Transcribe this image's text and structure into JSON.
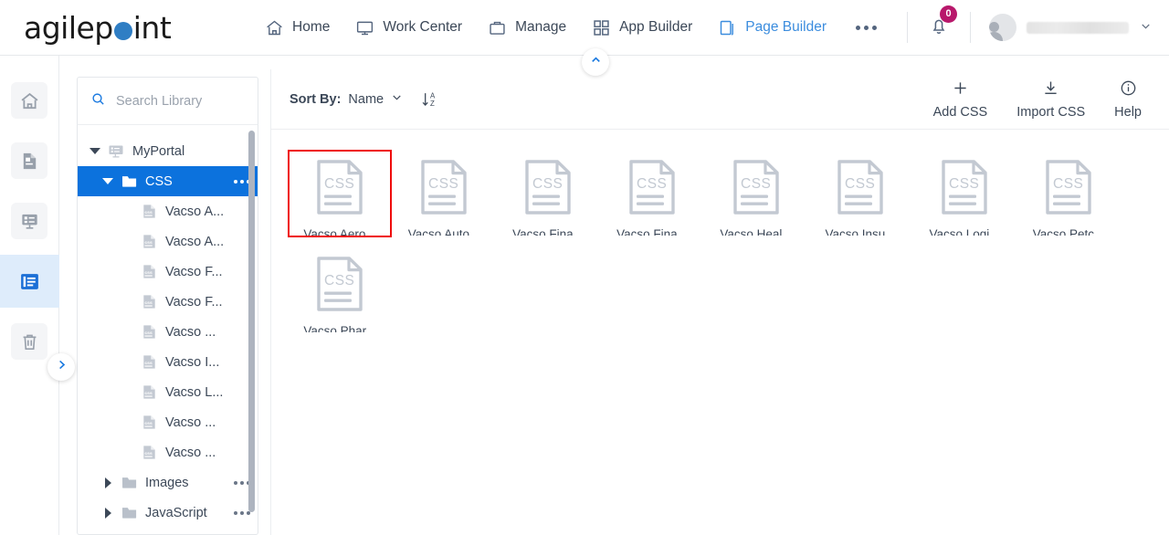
{
  "brand": {
    "name_part1": "agilep",
    "name_part2": "int",
    "dot_color": "#2f7ec4"
  },
  "header": {
    "nav": [
      {
        "label": "Home",
        "icon": "home-icon",
        "active": false
      },
      {
        "label": "Work Center",
        "icon": "monitor-icon",
        "active": false
      },
      {
        "label": "Manage",
        "icon": "briefcase-icon",
        "active": false
      },
      {
        "label": "App Builder",
        "icon": "grid-squares-icon",
        "active": false
      },
      {
        "label": "Page Builder",
        "icon": "pages-icon",
        "active": true
      }
    ],
    "more_label": "More",
    "notifications": {
      "count": "0",
      "badge_color": "#b8186b"
    },
    "user": {
      "name": "",
      "redacted": true
    }
  },
  "collapse_button": {
    "name": "collapse-header-button",
    "direction": "up"
  },
  "left_rail": {
    "items": [
      {
        "label": "Home",
        "icon": "home-icon",
        "active": false
      },
      {
        "label": "Pages",
        "icon": "page-icon",
        "active": false
      },
      {
        "label": "Forms",
        "icon": "form-icon",
        "active": false
      },
      {
        "label": "Library",
        "icon": "library-icon",
        "active": true
      },
      {
        "label": "Recycle Bin",
        "icon": "trash-icon",
        "active": false
      }
    ],
    "expand_label": "Expand"
  },
  "library": {
    "search": {
      "placeholder": "Search Library",
      "value": ""
    },
    "tree": [
      {
        "label": "MyPortal",
        "icon": "portal-icon",
        "depth": 0,
        "state": "expanded",
        "selected": false,
        "menu": false
      },
      {
        "label": "CSS",
        "icon": "folder-icon",
        "depth": 1,
        "state": "expanded",
        "selected": true,
        "menu": true
      },
      {
        "label": "Vacso A...",
        "icon": "css-file-icon",
        "depth": 2,
        "state": "leaf",
        "selected": false,
        "menu": false
      },
      {
        "label": "Vacso A...",
        "icon": "css-file-icon",
        "depth": 2,
        "state": "leaf",
        "selected": false,
        "menu": false
      },
      {
        "label": "Vacso F...",
        "icon": "css-file-icon",
        "depth": 2,
        "state": "leaf",
        "selected": false,
        "menu": false
      },
      {
        "label": "Vacso F...",
        "icon": "css-file-icon",
        "depth": 2,
        "state": "leaf",
        "selected": false,
        "menu": false
      },
      {
        "label": "Vacso ...",
        "icon": "css-file-icon",
        "depth": 2,
        "state": "leaf",
        "selected": false,
        "menu": false
      },
      {
        "label": "Vacso I...",
        "icon": "css-file-icon",
        "depth": 2,
        "state": "leaf",
        "selected": false,
        "menu": false
      },
      {
        "label": "Vacso L...",
        "icon": "css-file-icon",
        "depth": 2,
        "state": "leaf",
        "selected": false,
        "menu": false
      },
      {
        "label": "Vacso ...",
        "icon": "css-file-icon",
        "depth": 2,
        "state": "leaf",
        "selected": false,
        "menu": false
      },
      {
        "label": "Vacso ...",
        "icon": "css-file-icon",
        "depth": 2,
        "state": "leaf",
        "selected": false,
        "menu": false
      },
      {
        "label": "Images",
        "icon": "folder-icon",
        "depth": 1,
        "state": "collapsed",
        "selected": false,
        "menu": true
      },
      {
        "label": "JavaScript",
        "icon": "folder-icon",
        "depth": 1,
        "state": "collapsed",
        "selected": false,
        "menu": true
      }
    ]
  },
  "toolbar": {
    "sort_label": "Sort By:",
    "sort_value": "Name",
    "sort_direction": "ascending",
    "sort_direction_icon": "sort-a-z-icon",
    "actions": [
      {
        "label": "Add CSS",
        "icon": "plus-icon"
      },
      {
        "label": "Import CSS",
        "icon": "download-icon"
      },
      {
        "label": "Help",
        "icon": "info-circle-icon"
      }
    ]
  },
  "content": {
    "file_type": "CSS",
    "highlight_color": "#ef0b0b",
    "files": [
      {
        "label": "Vacso Aero...",
        "highlighted": true
      },
      {
        "label": "Vacso Auto...",
        "highlighted": false
      },
      {
        "label": "Vacso Fina...",
        "highlighted": false
      },
      {
        "label": "Vacso Fina...",
        "highlighted": false
      },
      {
        "label": "Vacso Heal...",
        "highlighted": false
      },
      {
        "label": "Vacso Insu...",
        "highlighted": false
      },
      {
        "label": "Vacso Logi...",
        "highlighted": false
      },
      {
        "label": "Vacso Petc...",
        "highlighted": false
      },
      {
        "label": "Vacso Phar...",
        "highlighted": false
      }
    ]
  }
}
